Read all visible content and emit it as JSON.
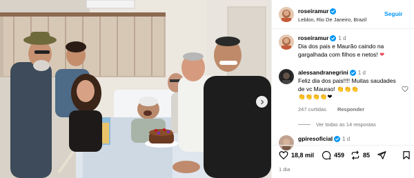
{
  "post": {
    "username": "roseiramur",
    "location": "Leblon, Rio De Janeiro, Brazil",
    "follow_label": "Seguir",
    "caption_time": "1 d",
    "caption_text": "Dia dos pais e Maurão caindo na gargalhada com filhos e netos!",
    "caption_emoji": "❤"
  },
  "comments": [
    {
      "username": "alessandranegrini",
      "time": "1 d",
      "text": "Feliz dia dos pais!!!! Muitas saudades de vc Maurao!",
      "emoji_tail": "👏👏👏",
      "emoji_line": "👏👏👏👏❤",
      "likes": "247 curtidas",
      "reply_label": "Responder"
    },
    {
      "username": "gpiresoficial",
      "time": "1 d"
    }
  ],
  "view_replies": "Ver todas as 14 respostas",
  "actions": {
    "likes": "18,8 mil",
    "comments": "459",
    "shares": "85"
  },
  "date": "1 dia",
  "colors": {
    "accent": "#0095f6",
    "verified": "#0095f6",
    "heart": "#ed4956"
  },
  "icons": [
    "verified-badge-icon",
    "heart-icon",
    "comment-icon",
    "repost-icon",
    "share-icon",
    "save-icon",
    "chevron-right-icon"
  ]
}
